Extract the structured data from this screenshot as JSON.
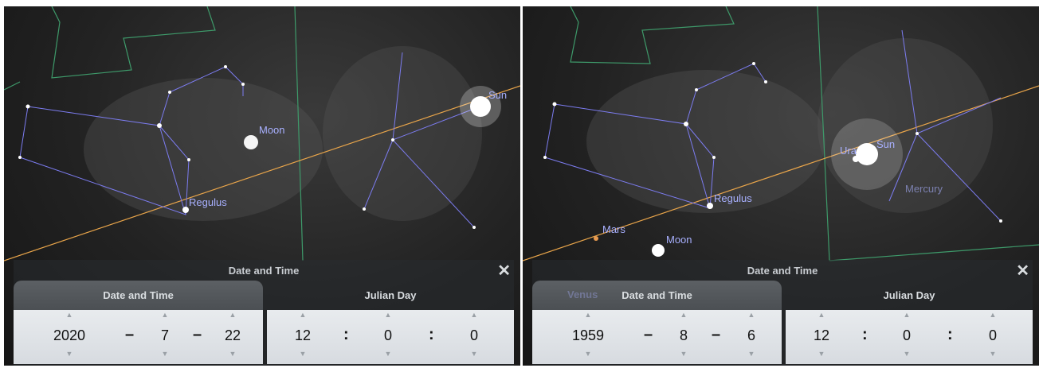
{
  "left": {
    "sky_labels": {
      "moon": "Moon",
      "sun": "Sun",
      "regulus": "Regulus"
    },
    "dialog": {
      "title": "Date and Time",
      "tab_date": "Date and Time",
      "tab_julian": "Julian Day",
      "year": "2020",
      "month": "7",
      "day": "22",
      "hour": "12",
      "minute": "0",
      "second": "0"
    }
  },
  "right": {
    "sky_labels": {
      "uranus": "Ura",
      "sun": "Sun",
      "mercury": "Mercury",
      "regulus": "Regulus",
      "mars": "Mars",
      "moon": "Moon",
      "venus": "Venus"
    },
    "dialog": {
      "title": "Date and Time",
      "tab_date": "Date and Time",
      "tab_julian": "Julian Day",
      "year": "1959",
      "month": "8",
      "day": "6",
      "hour": "12",
      "minute": "0",
      "second": "0"
    }
  },
  "symbols": {
    "date_sep": "–",
    "time_sep": ":",
    "close": "✕",
    "up": "▲",
    "down": "▼"
  },
  "colors": {
    "constellation": "#7c7cf0",
    "boundary": "#3e9a6a",
    "ecliptic": "#e9a54a",
    "label": "#a8b0ff"
  }
}
